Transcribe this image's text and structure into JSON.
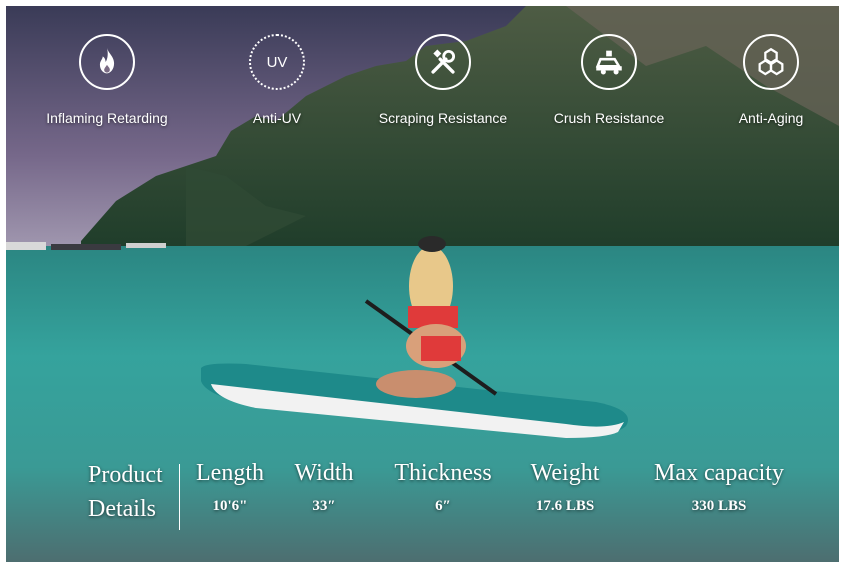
{
  "features": [
    {
      "label": "Inflaming Retarding",
      "icon": "flame-icon"
    },
    {
      "label": "Anti-UV",
      "icon": "uv-sun-icon",
      "icon_text": "UV"
    },
    {
      "label": "Scraping Resistance",
      "icon": "tools-icon"
    },
    {
      "label": "Crush Resistance",
      "icon": "car-crush-icon"
    },
    {
      "label": "Anti-Aging",
      "icon": "hexagon-molecule-icon"
    }
  ],
  "details": {
    "title_line1": "Product",
    "title_line2": "Details",
    "specs": [
      {
        "heading": "Length",
        "value": "10'6\""
      },
      {
        "heading": "Width",
        "value": "33″"
      },
      {
        "heading": "Thickness",
        "value": "6″"
      },
      {
        "heading": "Weight",
        "value": "17.6 LBS"
      },
      {
        "heading": "Max capacity",
        "value": "330 LBS"
      }
    ]
  },
  "colors": {
    "water": "#2f9b98",
    "board": "#1e8a8a",
    "swimsuit": "#e03a3a"
  }
}
